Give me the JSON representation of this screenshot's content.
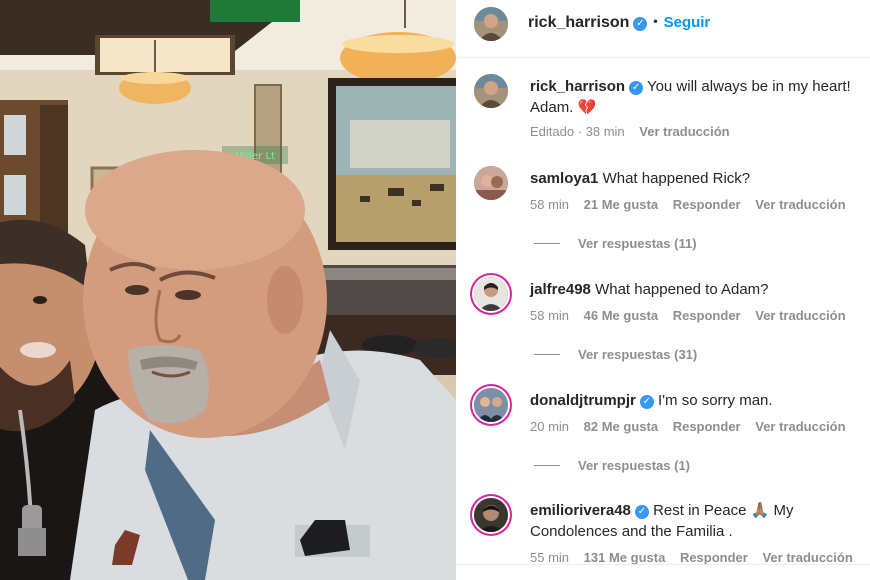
{
  "header": {
    "username": "rick_harrison",
    "follow_label": "Seguir",
    "separator": "•"
  },
  "caption": {
    "username": "rick_harrison",
    "text_line1": "You will always be in my heart!",
    "text_line2": "Adam. 💔",
    "edited_label": "Editado · 38 min",
    "translate_label": "Ver traducción"
  },
  "comments": [
    {
      "username": "samloya1",
      "verified": false,
      "text": "What happened Rick?",
      "time": "58 min",
      "likes": "21 Me gusta",
      "reply_label": "Responder",
      "translate_label": "Ver traducción",
      "replies_label": "Ver respuestas (11)"
    },
    {
      "username": "jalfre498",
      "verified": false,
      "text": "What happened to Adam?",
      "time": "58 min",
      "likes": "46 Me gusta",
      "reply_label": "Responder",
      "translate_label": "Ver traducción",
      "replies_label": "Ver respuestas (31)"
    },
    {
      "username": "donaldjtrumpjr",
      "verified": true,
      "text": "I'm so sorry man.",
      "time": "20 min",
      "likes": "82 Me gusta",
      "reply_label": "Responder",
      "translate_label": "Ver traducción",
      "replies_label": "Ver respuestas (1)"
    },
    {
      "username": "emiliorivera48",
      "verified": true,
      "text": "Rest in Peace 🙏🏽 My Condolences and the Familia .",
      "time": "55 min",
      "likes": "131 Me gusta",
      "reply_label": "Responder",
      "translate_label": "Ver traducción"
    }
  ],
  "colors": {
    "accent": "#0095f6",
    "verified": "#3897f0",
    "muted_text": "#8e8e8e",
    "story_ring": "#d6249f"
  }
}
